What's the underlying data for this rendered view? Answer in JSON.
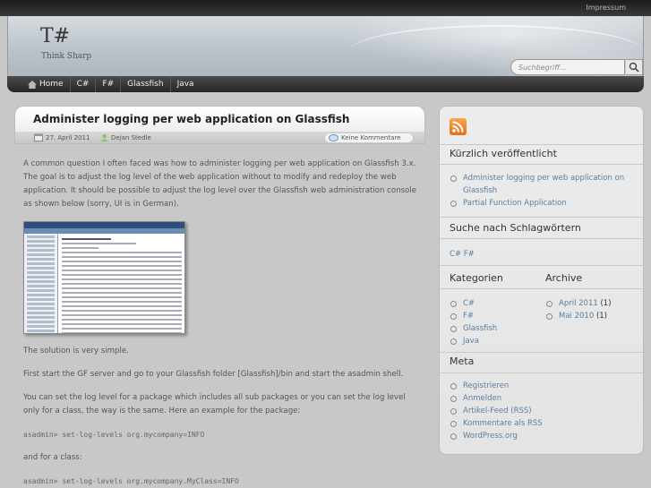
{
  "topbar": {
    "impressum": "Impressum"
  },
  "header": {
    "logo": "T#",
    "tagline": "Think Sharp"
  },
  "search": {
    "placeholder": "Suchbegriff..."
  },
  "nav": [
    {
      "label": "Home",
      "icon": "home-icon"
    },
    {
      "label": "C#"
    },
    {
      "label": "F#"
    },
    {
      "label": "Glassfish"
    },
    {
      "label": "Java"
    }
  ],
  "post": {
    "title": "Administer logging per web application on Glassfish",
    "date": "27. April 2011",
    "author": "Dejan Stedle",
    "comments": "Keine Kommentare",
    "p1": "A common question I often faced was how to administer logging per web application on Glassfish 3.x. The goal is to adjust the log level of the web application without to modify and redeploy the web application. It should be possible to adjust the log level over the Glassfish web administration console as shown below (sorry, UI is in German).",
    "p2": "The solution is very simple.",
    "p3": "First start the GF server and go to your Glassfish folder [Glassfish]/bin and start the asadmin shell.",
    "p4": "You can set the log level for a package which includes all sub packages or you can set the log level only for a class, the way is the same. Here an example for the package:",
    "code1": "asadmin> set-log-levels org.mycompany=INFO",
    "p5": "and for a class:",
    "code2": "asadmin> set-log-levels org.mycompany.MyClass=INFO"
  },
  "sidebar": {
    "recent_title": "Kürzlich veröffentlicht",
    "recent": [
      "Administer logging per web application on Glassfish",
      "Partial Function Application"
    ],
    "tags_title": "Suche nach Schlagwörtern",
    "tags": "C# F#",
    "categories_title": "Kategorien",
    "categories": [
      "C#",
      "F#",
      "Glassfish",
      "Java"
    ],
    "archive_title": "Archive",
    "archive": [
      {
        "label": "April 2011",
        "count": "(1)"
      },
      {
        "label": "Mai 2010",
        "count": "(1)"
      }
    ],
    "meta_title": "Meta",
    "meta": [
      "Registrieren",
      "Anmelden",
      "Artikel-Feed (RSS)",
      "Kommentare als RSS",
      "WordPress.org"
    ]
  },
  "colors": {
    "link": "#5a7ea0",
    "nav_bg": "#262626",
    "rss": "#e2701b"
  }
}
